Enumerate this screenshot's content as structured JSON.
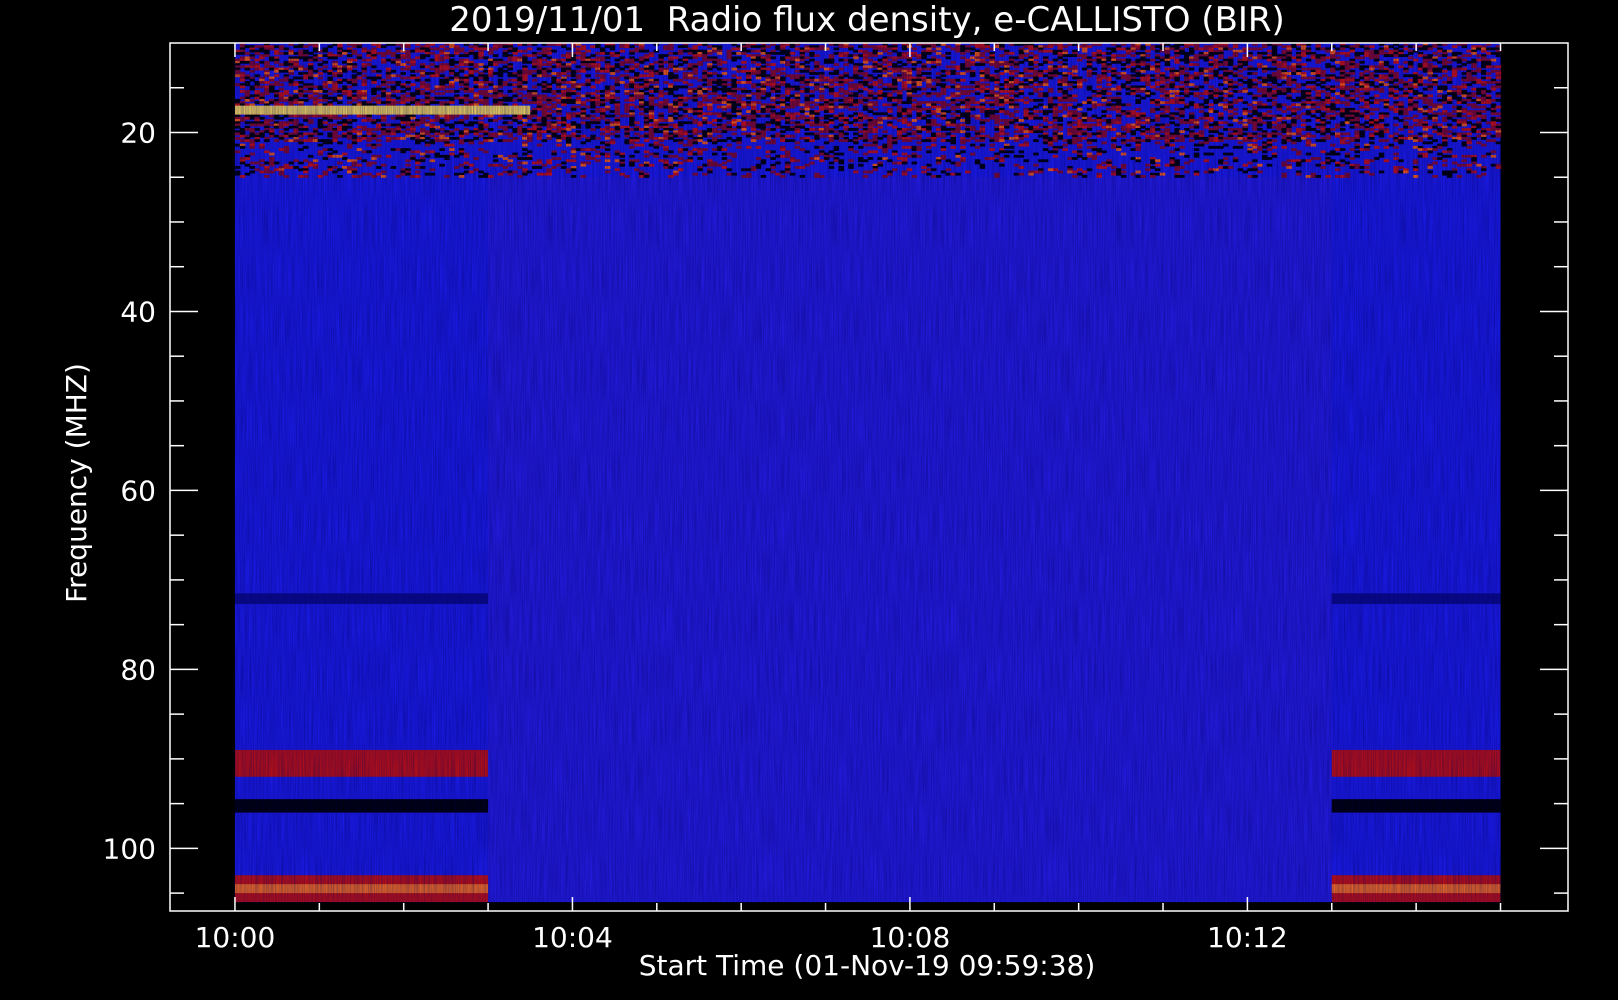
{
  "chart_data": {
    "type": "heatmap",
    "title": "2019/11/01  Radio flux density, e-CALLISTO (BIR)",
    "xlabel": "Start Time (01-Nov-19 09:59:38)",
    "ylabel": "Frequency (MHZ)",
    "x_ticks": [
      "10:00",
      "10:04",
      "10:08",
      "10:12"
    ],
    "x_tick_minutes": [
      0,
      4,
      8,
      12
    ],
    "xlim_minutes": [
      -0.77,
      15.8
    ],
    "data_range_minutes": [
      0,
      15
    ],
    "y_ticks": [
      20,
      40,
      60,
      80,
      100
    ],
    "ylim": [
      10,
      107
    ],
    "data_range_mhz": [
      10,
      106
    ],
    "y_inverted": true,
    "colormap": "blue-red-yellow",
    "colors": {
      "background": "#000000",
      "axis": "#ffffff",
      "low": "#1c1cf0",
      "mid": "#c00000",
      "high": "#ffff66"
    },
    "features": [
      {
        "label": "strong emission bands at low frequencies",
        "freq_mhz": [
          10,
          25
        ],
        "time_min": [
          0,
          15
        ]
      },
      {
        "label": "bright band",
        "freq_mhz": [
          17,
          18
        ],
        "time_min": [
          0,
          3.5
        ]
      },
      {
        "label": "interference band",
        "freq_mhz": [
          89,
          92
        ],
        "time_min": [
          0,
          3
        ]
      },
      {
        "label": "interference band",
        "freq_mhz": [
          89,
          92
        ],
        "time_min": [
          13,
          15
        ]
      },
      {
        "label": "interference band",
        "freq_mhz": [
          103,
          106
        ],
        "time_min": [
          0,
          3
        ]
      },
      {
        "label": "interference band",
        "freq_mhz": [
          103,
          106
        ],
        "time_min": [
          13,
          15
        ]
      },
      {
        "label": "dark band",
        "freq_mhz": [
          94.5,
          96
        ],
        "time_min": [
          0,
          3
        ]
      },
      {
        "label": "dark band",
        "freq_mhz": [
          94.5,
          96
        ],
        "time_min": [
          13,
          15
        ]
      }
    ]
  }
}
